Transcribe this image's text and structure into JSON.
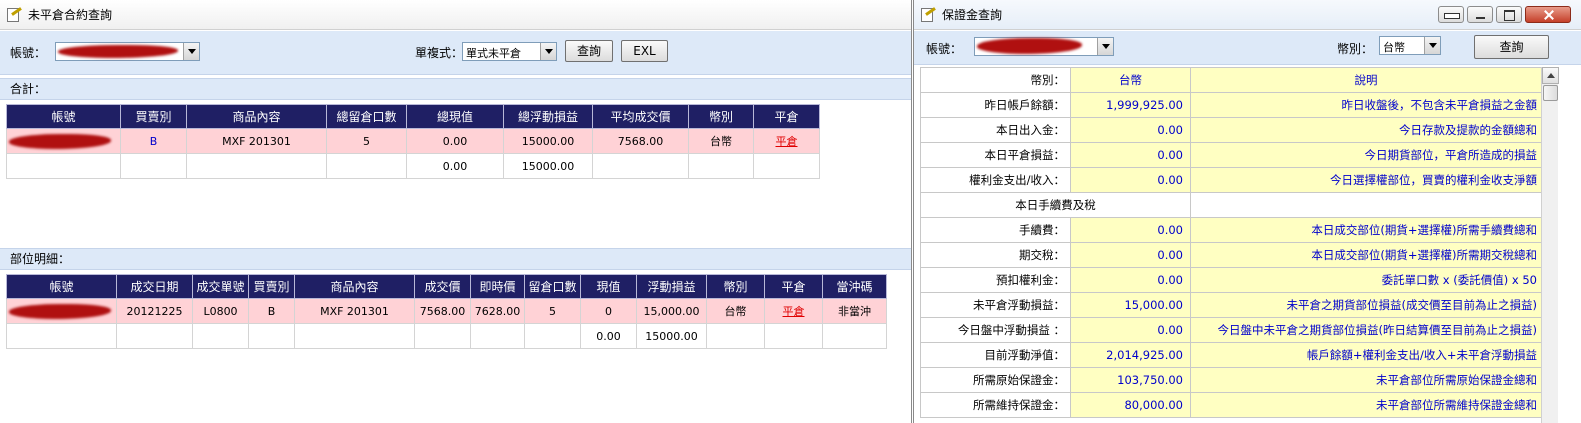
{
  "left_window": {
    "title": "未平倉合約查詢",
    "account_label": "帳號：",
    "mode_label": "單複式：",
    "mode_value": "單式未平倉",
    "query_label": "查詢",
    "exl_label": "EXL",
    "summary": {
      "title": "合計：",
      "headers": [
        "帳號",
        "買賣別",
        "商品內容",
        "總留倉口數",
        "總現值",
        "總浮動損益",
        "平均成交價",
        "幣別",
        "平倉"
      ],
      "rows": [
        [
          "",
          "B",
          "MXF 201301",
          "5",
          "0.00",
          "15000.00",
          "7568.00",
          "台幣",
          "平倉"
        ],
        [
          "",
          "",
          "",
          "",
          "0.00",
          "15000.00",
          "",
          "",
          ""
        ]
      ]
    },
    "detail": {
      "title": "部位明細：",
      "headers": [
        "帳號",
        "成交日期",
        "成交單號",
        "買賣別",
        "商品內容",
        "成交價",
        "即時價",
        "留倉口數",
        "現值",
        "浮動損益",
        "幣別",
        "平倉",
        "當沖碼"
      ],
      "rows": [
        [
          "",
          "20121225",
          "L0800",
          "B",
          "MXF 201301",
          "7568.00",
          "7628.00",
          "5",
          "0",
          "15,000.00",
          "台幣",
          "平倉",
          "非當沖"
        ],
        [
          "",
          "",
          "",
          "",
          "",
          "",
          "",
          "",
          "0.00",
          "15000.00",
          "",
          "",
          ""
        ]
      ]
    }
  },
  "right_window": {
    "title": "保證金查詢",
    "account_label": "帳號：",
    "currency_label": "幣別：",
    "currency_value": "台幣",
    "query_label": "查詢",
    "header_row": {
      "key": "幣別：",
      "value": "台幣",
      "desc": "說明"
    },
    "rows": [
      {
        "key": "昨日帳戶餘額：",
        "value": "1,999,925.00",
        "desc": "昨日收盤後，不包含未平倉損益之金額"
      },
      {
        "key": "本日出入金：",
        "value": "0.00",
        "desc": "今日存款及提款的金額總和"
      },
      {
        "key": "本日平倉損益：",
        "value": "0.00",
        "desc": "今日期貨部位，平倉所造成的損益"
      },
      {
        "key": "權利金支出/收入：",
        "value": "0.00",
        "desc": "今日選擇權部位，買賣的權利金收支淨額"
      }
    ],
    "section_title": "本日手續費及稅",
    "rows2": [
      {
        "key": "手續費：",
        "value": "0.00",
        "desc": "本日成交部位(期貨+選擇權)所需手續費總和"
      },
      {
        "key": "期交稅：",
        "value": "0.00",
        "desc": "本日成交部位(期貨+選擇權)所需期交稅總和"
      },
      {
        "key": "預扣權利金：",
        "value": "0.00",
        "desc": "委託單口數 x (委託價值) x 50"
      },
      {
        "key": "未平倉浮動損益：",
        "value": "15,000.00",
        "desc": "未平倉之期貨部位損益(成交價至目前為止之損益)"
      },
      {
        "key": "今日盤中浮動損益 ：",
        "value": "0.00",
        "desc": "今日盤中未平倉之期貨部位損益(昨日結算價至目前為止之損益)"
      },
      {
        "key": "目前浮動淨值：",
        "value": "2,014,925.00",
        "desc": "帳戶餘額+權利金支出/收入+未平倉浮動損益"
      },
      {
        "key": "所需原始保證金：",
        "value": "103,750.00",
        "desc": "未平倉部位所需原始保證金總和"
      },
      {
        "key": "所需維持保證金：",
        "value": "80,000.00",
        "desc": "未平倉部位所需維持保證金總和"
      }
    ]
  },
  "colors": {
    "header_navy": "#1f1f64",
    "row_pink": "#ffd2d6",
    "cell_yellow": "#ffffc2",
    "toolbar_blue": "#dde9f8",
    "value_blue": "#0000cc",
    "link_red": "#e00000"
  },
  "icons": [
    "app-icon",
    "dropdown-arrow-icon",
    "pin-icon",
    "minimize-icon",
    "maximize-icon",
    "close-icon",
    "scroll-up-icon"
  ]
}
